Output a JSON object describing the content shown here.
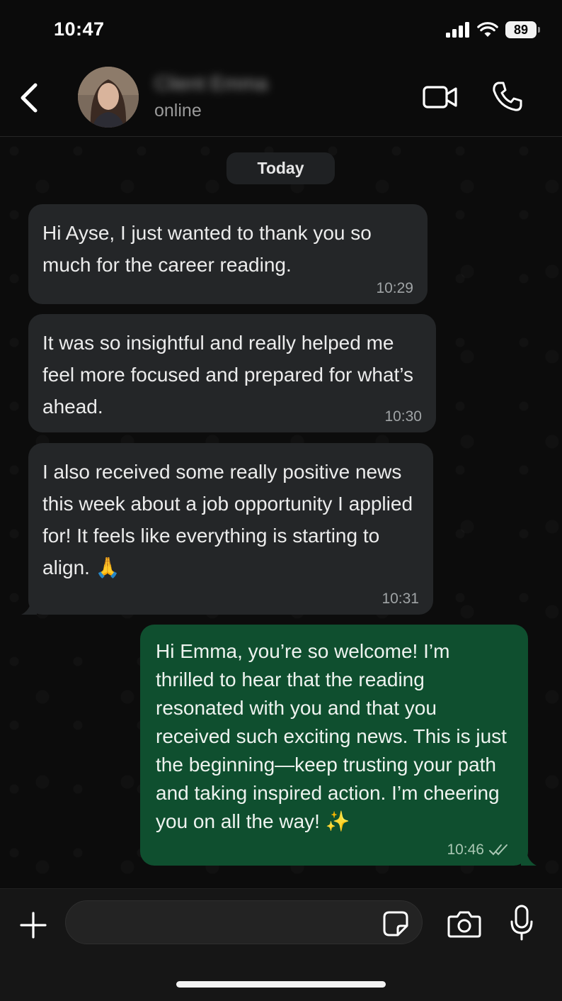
{
  "status_bar": {
    "time": "10:47",
    "battery": "89"
  },
  "header": {
    "contact_name": "Client Emma",
    "contact_status": "online",
    "icons": {
      "back": "chevron-left-icon",
      "video": "video-camera-icon",
      "call": "phone-icon"
    }
  },
  "chat": {
    "date_label": "Today",
    "messages": [
      {
        "direction": "incoming",
        "text": "Hi Ayse, I just wanted to thank you so much for the career reading.",
        "time": "10:29"
      },
      {
        "direction": "incoming",
        "text": "It was so insightful and really helped me feel more focused and prepared for what’s ahead.",
        "time": "10:30"
      },
      {
        "direction": "incoming",
        "text": "I also received some really positive news this week about a job opportunity I applied for! It feels like everything is starting to align. 🙏",
        "time": "10:31"
      },
      {
        "direction": "outgoing",
        "text": "Hi Emma, you’re so welcome! I’m thrilled to hear that the reading resonated with you and that you received such exciting news. This is just the beginning—keep trusting your path and taking inspired action. I’m cheering you on all the way! ✨",
        "time": "10:46",
        "read_receipt": "double-check-icon"
      }
    ]
  },
  "input_bar": {
    "placeholder": "",
    "icons": {
      "add": "plus-icon",
      "sticker": "sticker-icon",
      "camera": "camera-icon",
      "mic": "microphone-icon"
    }
  },
  "colors": {
    "incoming_bubble": "#242628",
    "outgoing_bubble": "#0f4f2f",
    "background": "#0b0b0b"
  }
}
